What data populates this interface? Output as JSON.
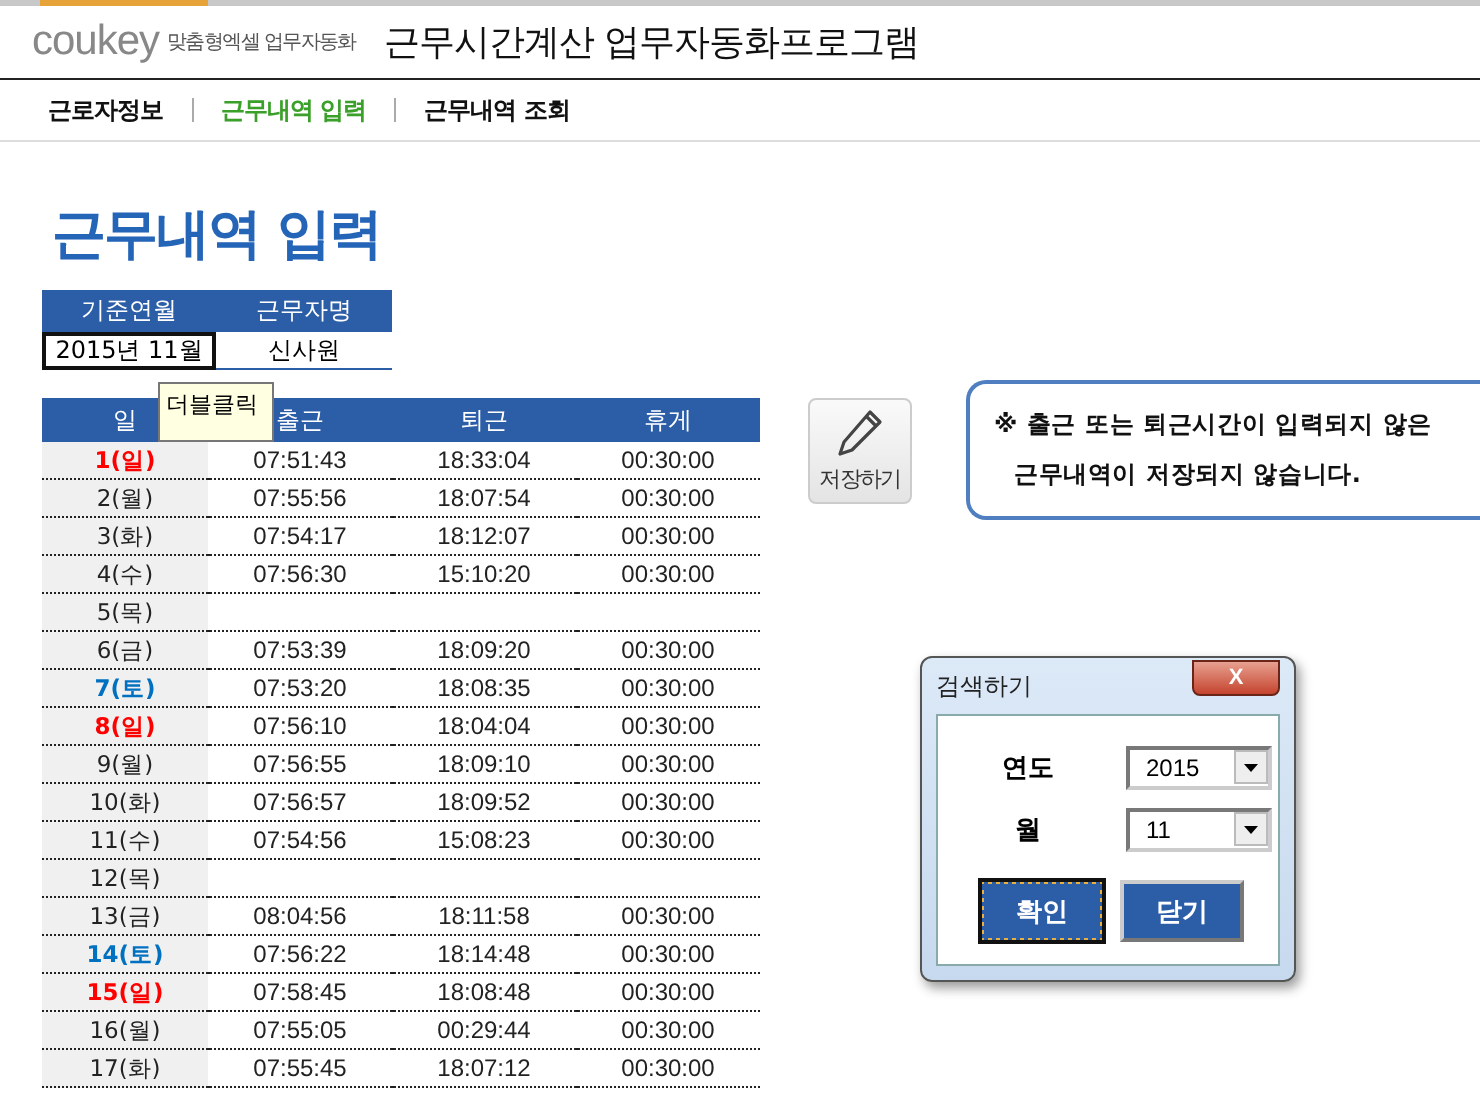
{
  "header": {
    "logo": "coukey",
    "tagline": "맞춤형엑셀 업무자동화",
    "title": "근무시간계산 업무자동화프로그램"
  },
  "nav": [
    {
      "label": "근로자정보",
      "selected": false
    },
    {
      "label": "근무내역 입력",
      "selected": true
    },
    {
      "label": "근무내역 조회",
      "selected": false
    }
  ],
  "page_title": "근무내역 입력",
  "info_table": {
    "columns": [
      "기준연월",
      "근무자명"
    ],
    "values": [
      "2015년 11월",
      "신사원"
    ]
  },
  "tooltip": "더블클릭",
  "table": {
    "columns": [
      "일",
      "출근",
      "퇴근",
      "휴게"
    ],
    "rows": [
      {
        "color": "#ff0000",
        "cells": [
          "1(일)",
          "07:51:43",
          "18:33:04",
          "00:30:00"
        ]
      },
      {
        "cells": [
          "2(월)",
          "07:55:56",
          "18:07:54",
          "00:30:00"
        ]
      },
      {
        "cells": [
          "3(화)",
          "07:54:17",
          "18:12:07",
          "00:30:00"
        ]
      },
      {
        "cells": [
          "4(수)",
          "07:56:30",
          "15:10:20",
          "00:30:00"
        ]
      },
      {
        "cells": [
          "5(목)"
        ]
      },
      {
        "cells": [
          "6(금)",
          "07:53:39",
          "18:09:20",
          "00:30:00"
        ]
      },
      {
        "color": "#0070c0",
        "cells": [
          "7(토)",
          "07:53:20",
          "18:08:35",
          "00:30:00"
        ]
      },
      {
        "color": "#ff0000",
        "cells": [
          "8(일)",
          "07:56:10",
          "18:04:04",
          "00:30:00"
        ]
      },
      {
        "cells": [
          "9(월)",
          "07:56:55",
          "18:09:10",
          "00:30:00"
        ]
      },
      {
        "cells": [
          "10(화)",
          "07:56:57",
          "18:09:52",
          "00:30:00"
        ]
      },
      {
        "cells": [
          "11(수)",
          "07:54:56",
          "15:08:23",
          "00:30:00"
        ]
      },
      {
        "cells": [
          "12(목)"
        ]
      },
      {
        "cells": [
          "13(금)",
          "08:04:56",
          "18:11:58",
          "00:30:00"
        ]
      },
      {
        "color": "#0070c0",
        "cells": [
          "14(토)",
          "07:56:22",
          "18:14:48",
          "00:30:00"
        ]
      },
      {
        "color": "#ff0000",
        "cells": [
          "15(일)",
          "07:58:45",
          "18:08:48",
          "00:30:00"
        ]
      },
      {
        "cells": [
          "16(월)",
          "07:55:05",
          "00:29:44",
          "00:30:00"
        ]
      },
      {
        "cells": [
          "17(화)",
          "07:55:45",
          "18:07:12",
          "00:30:00"
        ]
      }
    ]
  },
  "save_button": "저장하기",
  "notice": [
    "※ 출근 또는 퇴근시간이 입력되지 않은",
    "근무내역이 저장되지 않습니다."
  ],
  "dialog": {
    "title": "검색하기",
    "close": "X",
    "fields": [
      {
        "label": "연도",
        "value": "2015"
      },
      {
        "label": "월",
        "value": "11"
      }
    ],
    "buttons": [
      {
        "label": "확인",
        "selected": true
      },
      {
        "label": "닫기",
        "selected": false
      }
    ]
  }
}
